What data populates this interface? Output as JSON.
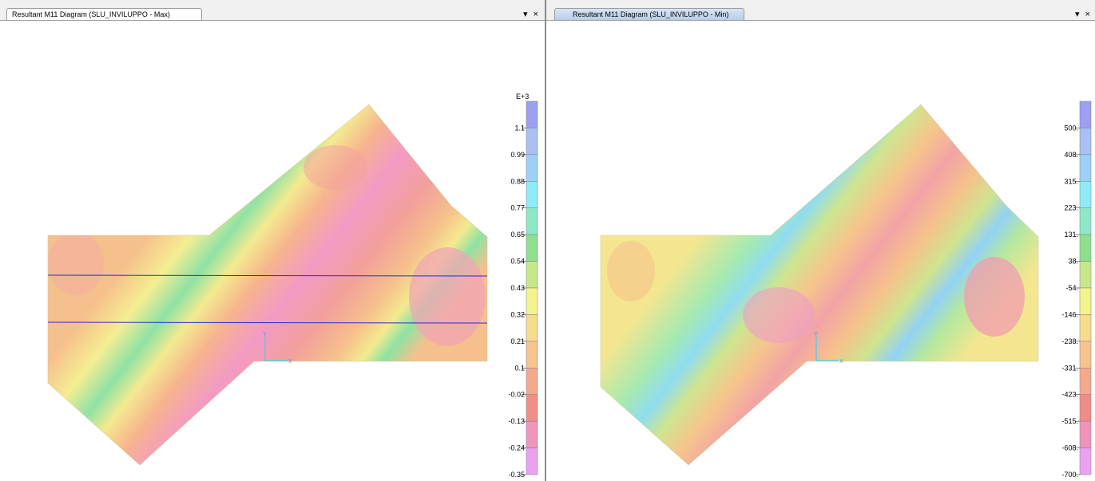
{
  "left_panel": {
    "tab_title": "Resultant M11 Diagram   (SLU_INVILUPPO - Max)",
    "tab_controls": "▾ ×",
    "legend": {
      "exponent": "E+3",
      "labels": [
        "1.1",
        "0.99",
        "0.88",
        "0.77",
        "0.65",
        "0.54",
        "0.43",
        "0.32",
        "0.21",
        "0.1",
        "-0.02",
        "-0.13",
        "-0.24",
        "-0.35"
      ]
    },
    "axis_labels": {
      "x": "X",
      "y": "Y"
    }
  },
  "right_panel": {
    "tab_title": "Resultant M11 Diagram   (SLU_INVILUPPO - Min)",
    "tab_controls": "▾ ×",
    "legend": {
      "exponent": "",
      "labels": [
        "500.",
        "408.",
        "315.",
        "223.",
        "131.",
        "38.",
        "-54.",
        "-146.",
        "-238.",
        "-331.",
        "-423.",
        "-515.",
        "-608.",
        "-700."
      ]
    },
    "axis_labels": {
      "x": "X",
      "y": "Y"
    }
  },
  "colors": {
    "legend_scale": [
      "#9c9ff2",
      "#a9c0f3",
      "#9ecff5",
      "#8eecf6",
      "#8fe8c5",
      "#8ee08c",
      "#c6e889",
      "#f4f48e",
      "#f6dc8b",
      "#f6c48c",
      "#f5a98b",
      "#f28c86",
      "#f094b9",
      "#e9a3ee"
    ],
    "outline": "#2a2ad6",
    "axis": "#33d6f0"
  }
}
